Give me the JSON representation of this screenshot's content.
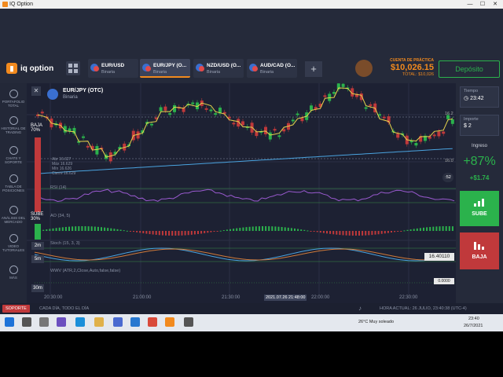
{
  "window": {
    "title": "IQ Option"
  },
  "header": {
    "logo_text": "iq option",
    "tabs": [
      {
        "name": "EUR/USD",
        "sub": "Binaria"
      },
      {
        "name": "EUR/JPY (O...",
        "sub": "Binaria"
      },
      {
        "name": "NZD/USD (O...",
        "sub": "Binaria"
      },
      {
        "name": "AUD/CAD (O...",
        "sub": "Binaria"
      }
    ],
    "account_label": "CUENTA DE PRÁCTICA",
    "balance": "$10,026.15",
    "total": "TOTAL: $10,026",
    "deposit_label": "Depósito"
  },
  "sidebar": [
    {
      "label": "PORTAFOLIO TOTAL",
      "icon": "briefcase-icon"
    },
    {
      "label": "HISTORIAL DE TRADING",
      "icon": "history-icon"
    },
    {
      "label": "CHATS Y SOPORTE",
      "icon": "chat-icon"
    },
    {
      "label": "TABLA DE POSICIONES",
      "icon": "trophy-icon"
    },
    {
      "label": "ANÁLISIS DEL MERCADO",
      "icon": "analysis-icon"
    },
    {
      "label": "VIDEO TUTORIALES",
      "icon": "video-icon"
    },
    {
      "label": "MÁS",
      "icon": "more-icon"
    }
  ],
  "chart": {
    "asset": "EUR/JPY (OTC)",
    "asset_sub": "Binaria",
    "baja_label": "BAJA",
    "baja_pct": "70%",
    "sube_label": "SUBE",
    "sube_pct": "30%",
    "ohlc": [
      "Abr 16.627",
      "Máx 16.629",
      "Mín 16.626",
      "Cierre 16.629"
    ],
    "indicators": [
      "RSI (14)",
      "AO (34, 5)",
      "Stoch (15, 3, 3)",
      "WWV (ATR,2,Close,Auto,false,false)"
    ],
    "timeframes": [
      "2m",
      "5m",
      "30m"
    ],
    "price_right": [
      "16.2",
      "16.0"
    ],
    "countdown": ":52",
    "stoch_value": "16.40110",
    "wwv_value": "0.0000",
    "x_ticks": [
      "20:30:00",
      "21:00:00",
      "21:30:00",
      "22:00:00",
      "22:30:00"
    ],
    "cursor_time": "2021.07.26 21:48:00"
  },
  "chart_data": {
    "type": "line",
    "title": "EUR/JPY (OTC)",
    "x": [
      "20:30:00",
      "21:00:00",
      "21:30:00",
      "22:00:00",
      "22:30:00"
    ],
    "series": [],
    "xlabel": "",
    "ylabel": ""
  },
  "right_panel": {
    "time_label": "Tiempo",
    "time_value": "23:42",
    "amount_label": "Importe",
    "amount_value": "$ 2",
    "ingreso_label": "Ingreso",
    "payout_pct": "+87%",
    "payout_amount": "+$1.74",
    "up_label": "SUBE",
    "down_label": "BAJA"
  },
  "statusbar": {
    "support": "SOPORTE",
    "message": "CADA DÍA, TODO EL DÍA",
    "current_time": "HORA ACTUAL: 26 JULIO, 23:40:38 (UTC-4)"
  },
  "taskbar": {
    "weather": "26°C  Muy soleado",
    "clock": "23:40",
    "date": "26/7/2021"
  },
  "colors": {
    "accent": "#f28a1e",
    "up": "#2bb24c",
    "down": "#c0393b"
  }
}
